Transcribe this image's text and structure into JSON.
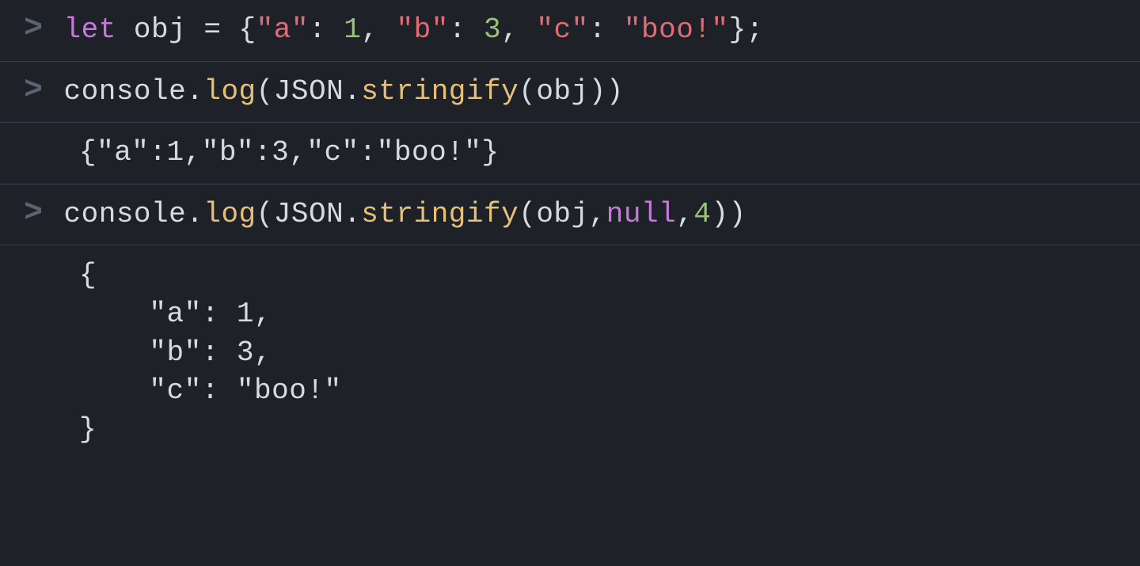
{
  "prompt_symbol": ">",
  "colors": {
    "keyword": "#c678dd",
    "method": "#e5c07b",
    "string": "#e06c75",
    "number": "#98c379",
    "default": "#d7dae0",
    "prompt": "#5c6370",
    "bg": "#1e2127"
  },
  "lines": [
    {
      "type": "input",
      "tokens": [
        {
          "cls": "keyword",
          "t": "let"
        },
        {
          "cls": "default",
          "t": " obj = {"
        },
        {
          "cls": "string",
          "t": "\"a\""
        },
        {
          "cls": "default",
          "t": ": "
        },
        {
          "cls": "number",
          "t": "1"
        },
        {
          "cls": "default",
          "t": ", "
        },
        {
          "cls": "string",
          "t": "\"b\""
        },
        {
          "cls": "default",
          "t": ": "
        },
        {
          "cls": "number",
          "t": "3"
        },
        {
          "cls": "default",
          "t": ", "
        },
        {
          "cls": "string",
          "t": "\"c\""
        },
        {
          "cls": "default",
          "t": ": "
        },
        {
          "cls": "string",
          "t": "\"boo!\""
        },
        {
          "cls": "default",
          "t": "};"
        }
      ]
    },
    {
      "type": "input",
      "tokens": [
        {
          "cls": "default",
          "t": "console."
        },
        {
          "cls": "method",
          "t": "log"
        },
        {
          "cls": "default",
          "t": "(JSON."
        },
        {
          "cls": "method",
          "t": "stringify"
        },
        {
          "cls": "default",
          "t": "(obj))"
        }
      ]
    },
    {
      "type": "output",
      "text": "{\"a\":1,\"b\":3,\"c\":\"boo!\"}"
    },
    {
      "type": "input",
      "tokens": [
        {
          "cls": "default",
          "t": "console."
        },
        {
          "cls": "method",
          "t": "log"
        },
        {
          "cls": "default",
          "t": "(JSON."
        },
        {
          "cls": "method",
          "t": "stringify"
        },
        {
          "cls": "default",
          "t": "(obj,"
        },
        {
          "cls": "null",
          "t": "null"
        },
        {
          "cls": "default",
          "t": ","
        },
        {
          "cls": "number",
          "t": "4"
        },
        {
          "cls": "default",
          "t": "))"
        }
      ]
    },
    {
      "type": "output",
      "text": "{\n    \"a\": 1,\n    \"b\": 3,\n    \"c\": \"boo!\"\n}"
    }
  ]
}
